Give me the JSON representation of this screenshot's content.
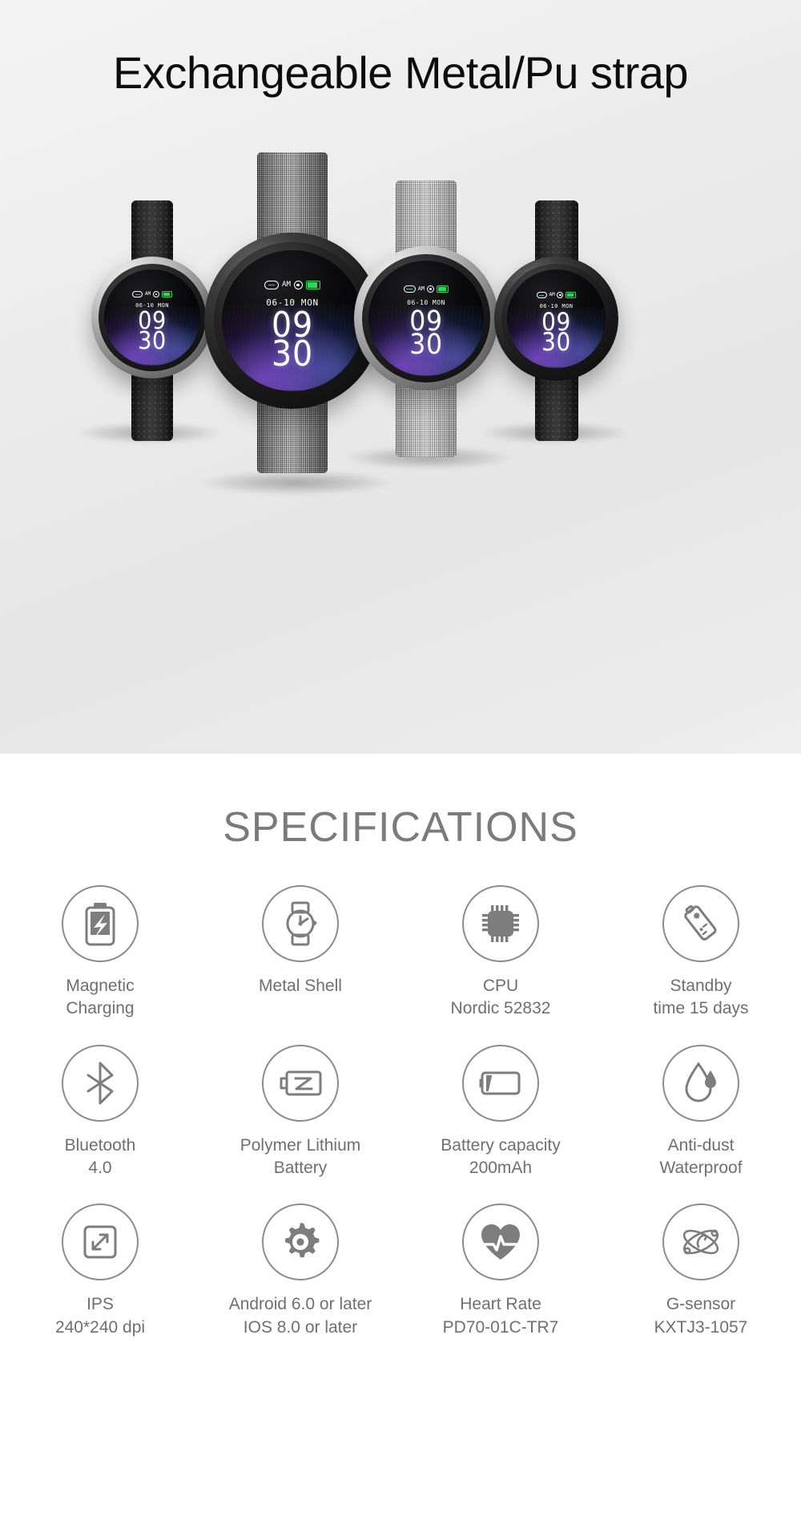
{
  "hero": {
    "title": "Exchangeable Metal/Pu strap",
    "background_color": "#eaeaea",
    "watches": [
      {
        "id": "watch-left-small",
        "case_finish": "silver",
        "strap_type": "pu",
        "strap_label": "PU perforated strap"
      },
      {
        "id": "watch-center-large",
        "case_finish": "dark",
        "strap_type": "mesh",
        "strap_label": "Dark milanese mesh strap"
      },
      {
        "id": "watch-center-right",
        "case_finish": "silver",
        "strap_type": "mesh-light",
        "strap_label": "Silver milanese mesh strap"
      },
      {
        "id": "watch-right-small",
        "case_finish": "dark",
        "strap_type": "pu",
        "strap_label": "PU perforated strap"
      }
    ],
    "watch_face": {
      "status_icons": [
        "link-icon",
        "meridiem",
        "alarm-icon",
        "battery-icon"
      ],
      "meridiem": "AM",
      "date": "06-10 MON",
      "hours": "09",
      "minutes": "30",
      "accent_color": "#23c3c8",
      "battery_color": "#2fd45a"
    }
  },
  "specs": {
    "title": "SPECIFICATIONS",
    "text_color": "#6f6f6f",
    "icon_border_color": "#8c8c8c",
    "items": [
      {
        "icon": "magnetic-charging-icon",
        "label": "Magnetic\nCharging"
      },
      {
        "icon": "metal-watch-icon",
        "label": "Metal Shell"
      },
      {
        "icon": "cpu-chip-icon",
        "label": "CPU\nNordic 52832"
      },
      {
        "icon": "standby-battery-icon",
        "label": "Standby\ntime 15 days"
      },
      {
        "icon": "bluetooth-icon",
        "label": "Bluetooth\n4.0"
      },
      {
        "icon": "lithium-battery-icon",
        "label": "Polymer Lithium\nBattery"
      },
      {
        "icon": "battery-capacity-icon",
        "label": "Battery capacity\n200mAh"
      },
      {
        "icon": "water-drop-icon",
        "label": "Anti-dust\nWaterproof"
      },
      {
        "icon": "resize-screen-icon",
        "label": "IPS\n240*240 dpi"
      },
      {
        "icon": "gear-icon",
        "label": "Android 6.0 or later\nIOS 8.0 or later"
      },
      {
        "icon": "heart-rate-icon",
        "label": "Heart Rate\nPD70-01C-TR7"
      },
      {
        "icon": "g-sensor-atom-icon",
        "label": "G-sensor\nKXTJ3-1057"
      }
    ]
  }
}
